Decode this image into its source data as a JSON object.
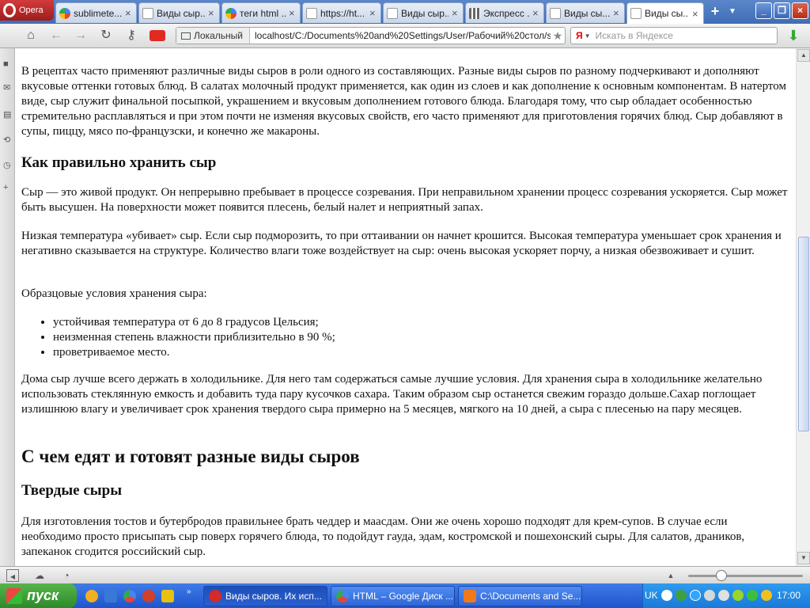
{
  "browser": {
    "menu_label": "Opera",
    "tabs": [
      {
        "label": "sublimete...",
        "icon": "google-icon"
      },
      {
        "label": "Виды сыр...",
        "icon": "page-icon"
      },
      {
        "label": "теги html ...",
        "icon": "google-icon"
      },
      {
        "label": "https://ht...",
        "icon": "page-icon"
      },
      {
        "label": "Виды сыр...",
        "icon": "page-icon"
      },
      {
        "label": "Экспресс ...",
        "icon": "speed-dial-icon"
      },
      {
        "label": "Виды сы...",
        "icon": "page-icon"
      },
      {
        "label": "Виды сы...",
        "icon": "page-icon",
        "active": true
      }
    ],
    "new_tab": "+",
    "address": {
      "scope": "Локальный",
      "url": "localhost/C:/Documents%20and%20Settings/User/Рабочий%20стол/site.h"
    },
    "search": {
      "brand": "Я",
      "placeholder": "Искать в Яндексе"
    }
  },
  "page": {
    "paragraphs_top": [
      "В рецептах часто применяют различные виды сыров в роли одного из составляющих. Разные виды сыров по разному подчеркивают и дополняют вкусовые оттенки готовых блюд. В салатах молочный продукт применяется, как один из слоев и как дополнение к основным компонентам. В натертом виде, сыр служит финальной посыпкой, украшением и вкусовым дополнением готового блюда. Благодаря тому, что сыр обладает особенностью стремительно расплавляться и при этом почти не изменяя вкусовых свойств, его часто применяют для приготовления горячих блюд. Сыр добавляют в супы, пиццу, мясо по-французски, и конечно же макароны."
    ],
    "h_storage": "Как правильно хранить сыр",
    "p_storage1": "Сыр — это живой продукт. Он непрерывно пребывает в процессе созревания. При неправильном хранении процесс созревания ускоряется. Сыр может быть высушен. На поверхности может появится плесень, белый налет и неприятный запах.",
    "p_storage2": "Низкая температура «убивает» сыр. Если сыр подморозить, то при оттаивании он начнет крошится. Высокая температура уменьшает срок хранения и негативно сказывается на структуре. Количество влаги тоже воздействует на сыр: очень высокая ускоряет порчу, а низкая обезвоживает и сушит.",
    "p_conditions": "Образцовые условия хранения сыра:",
    "conditions": [
      "устойчивая температура от 6 до 8 градусов Цельсия;",
      "неизменная степень влажности приблизительно в 90 %;",
      "проветриваемое место."
    ],
    "p_fridge": "Дома сыр лучше всего держать в холодильнике. Для него там содержаться самые лучшие условия. Для хранения сыра в холодильнике желательно использовать стеклянную емкость и добавить туда пару кусочков сахара. Таким образом сыр останется свежим гораздо дольше.Сахар поглощает излишнюю влагу и увеличивает срок хранения твердого сыра примерно на 5 месяцев, мягкого на 10 дней, а сыра с плесенью на пару месяцев.",
    "h_eat": "С чем едят и готовят разные виды сыров",
    "h_hard": "Твердые сыры",
    "p_hard": "Для изготовления тостов и бутербродов правильнее брать чеддер и маасдам. Они же очень хорошо подходят для крем-супов. В случае если необходимо просто присыпать сыр поверх горячего блюда, то подойдут гауда, эдам, костромской и пошехонский сыры. Для салатов, драников, запеканок сгодится российский сыр."
  },
  "taskbar": {
    "start_label": "пуск",
    "tasks": [
      {
        "label": "Виды сыров. Их исп...",
        "icon_color": "#d32a2a"
      },
      {
        "label": "HTML – Google Диск ...",
        "icon_color": "#f2b21c"
      },
      {
        "label": "C:\\Documents and Se...",
        "icon_color": "#f07a1a"
      }
    ],
    "lang": "UK",
    "clock": "17:00"
  }
}
